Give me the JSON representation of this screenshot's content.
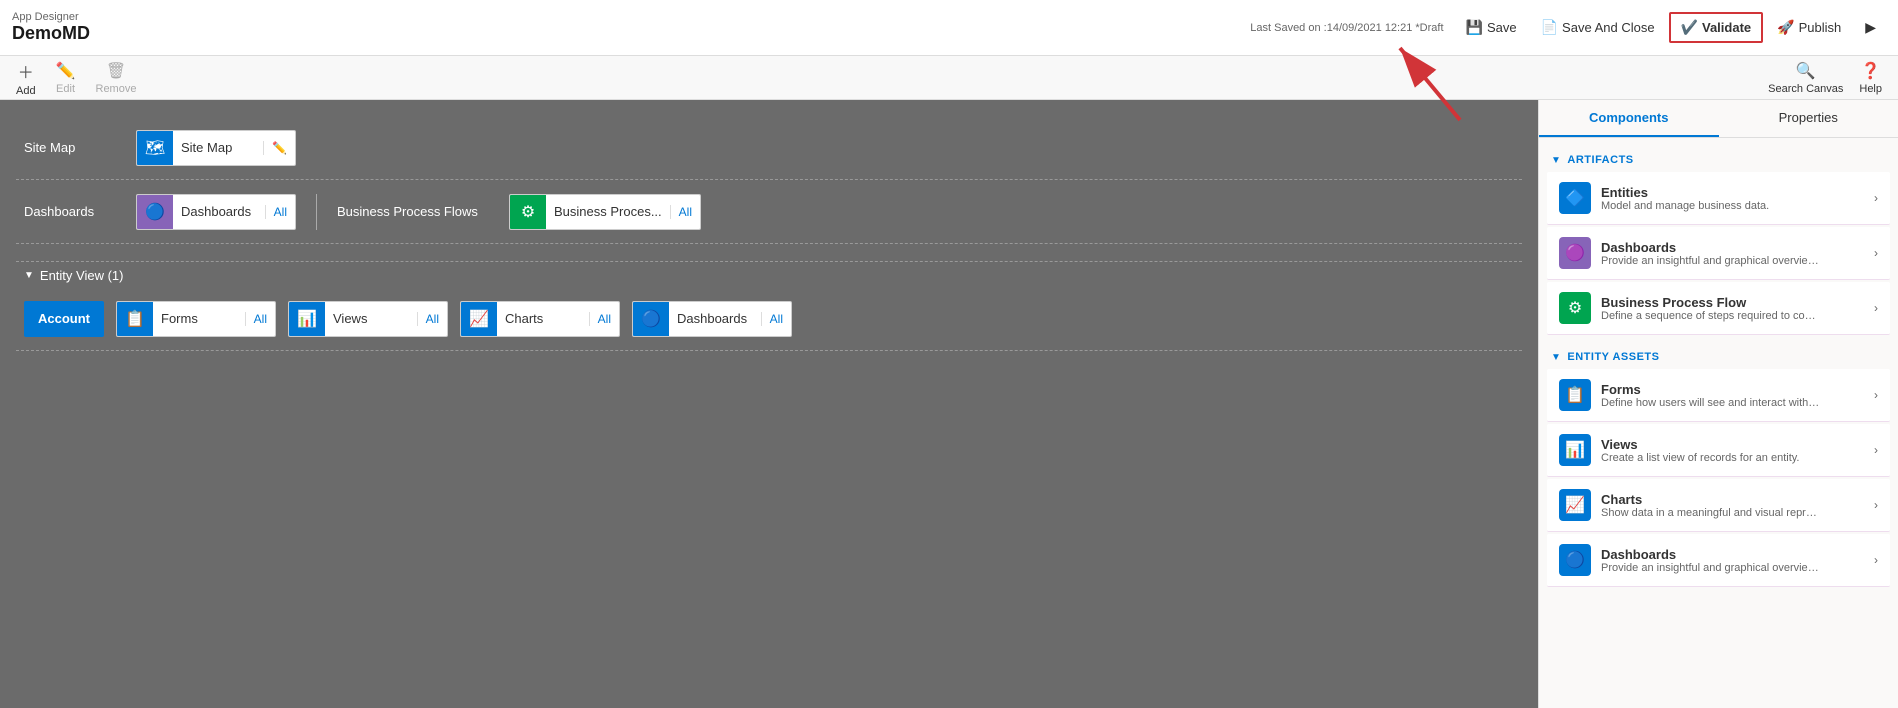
{
  "appDesigner": {
    "label": "App Designer",
    "appName": "DemoMD"
  },
  "lastSaved": "Last Saved on :14/09/2021 12:21 *Draft",
  "toolbar": {
    "save_label": "Save",
    "save_and_close_label": "Save And Close",
    "validate_label": "Validate",
    "publish_label": "Publish",
    "play_label": "Play"
  },
  "actions": {
    "add": "Add",
    "edit": "Edit",
    "remove": "Remove",
    "search_canvas": "Search Canvas",
    "help": "Help"
  },
  "canvas": {
    "site_map_label": "Site Map",
    "site_map_item": "Site Map",
    "dashboards_label": "Dashboards",
    "dashboards_item": "Dashboards",
    "dashboards_all": "All",
    "bpf_label": "Business Process Flows",
    "bpf_item": "Business Proces...",
    "bpf_all": "All",
    "entity_view": "Entity View (1)",
    "account_btn": "Account",
    "forms_item": "Forms",
    "forms_all": "All",
    "views_item": "Views",
    "views_all": "All",
    "charts_item": "Charts",
    "charts_all": "All",
    "entity_dashboards_item": "Dashboards",
    "entity_dashboards_all": "All"
  },
  "rightPanel": {
    "tab_components": "Components",
    "tab_properties": "Properties",
    "section_artifacts": "ARTIFACTS",
    "section_entity_assets": "ENTITY ASSETS",
    "artifacts": [
      {
        "title": "Entities",
        "desc": "Model and manage business data.",
        "icon": "blue",
        "icon_char": "🔷"
      },
      {
        "title": "Dashboards",
        "desc": "Provide an insightful and graphical overview of bu...",
        "icon": "purple",
        "icon_char": "🟣"
      },
      {
        "title": "Business Process Flow",
        "desc": "Define a sequence of steps required to complete ...",
        "icon": "green",
        "icon_char": "🟢"
      }
    ],
    "entity_assets": [
      {
        "title": "Forms",
        "desc": "Define how users will see and interact with busine...",
        "icon": "blue",
        "icon_char": "📋"
      },
      {
        "title": "Views",
        "desc": "Create a list view of records for an entity.",
        "icon": "blue",
        "icon_char": "📋"
      },
      {
        "title": "Charts",
        "desc": "Show data in a meaningful and visual representati...",
        "icon": "blue",
        "icon_char": "📊"
      },
      {
        "title": "Dashboards",
        "desc": "Provide an insightful and graphical overview of bu...",
        "icon": "blue",
        "icon_char": "🔵"
      }
    ]
  }
}
